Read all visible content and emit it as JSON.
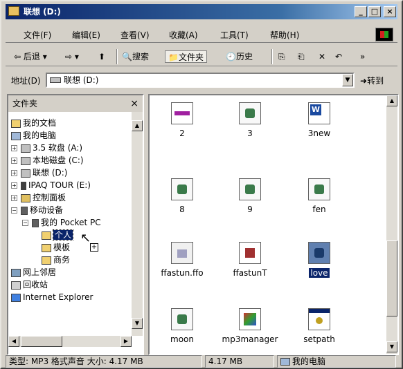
{
  "window": {
    "title": "联想 (D:)"
  },
  "menubar": {
    "items": [
      "文件(F)",
      "编辑(E)",
      "查看(V)",
      "收藏(A)",
      "工具(T)",
      "帮助(H)"
    ]
  },
  "toolbar": {
    "back": "后退",
    "search": "搜索",
    "folders": "文件夹",
    "history": "历史"
  },
  "address": {
    "label": "地址(D)",
    "value": "联想 (D:)",
    "go": "转到"
  },
  "folders_pane": {
    "title": "文件夹",
    "items": [
      "我的文档",
      "我的电脑",
      "3.5 软盘 (A:)",
      "本地磁盘 (C:)",
      "联想 (D:)",
      "IPAQ TOUR (E:)",
      "控制面板",
      "移动设备",
      "我的 Pocket PC",
      "个人",
      "模板",
      "商务",
      "网上邻居",
      "回收站",
      "Internet Explorer"
    ]
  },
  "files": [
    {
      "name": "2",
      "icon": "drag-file-icon"
    },
    {
      "name": "3",
      "icon": "sound-file-icon"
    },
    {
      "name": "3new",
      "icon": "word-document-icon"
    },
    {
      "name": "8",
      "icon": "sound-file-icon"
    },
    {
      "name": "9",
      "icon": "sound-file-icon"
    },
    {
      "name": "fen",
      "icon": "sound-file-icon"
    },
    {
      "name": "ffastun.ffo",
      "icon": "generic-file-icon"
    },
    {
      "name": "ffastunT",
      "icon": "application-icon"
    },
    {
      "name": "love",
      "icon": "sound-file-icon"
    },
    {
      "name": "moon",
      "icon": "sound-file-icon"
    },
    {
      "name": "mp3manager",
      "icon": "application-icon"
    },
    {
      "name": "setpath",
      "icon": "settings-window-icon"
    }
  ],
  "status": {
    "type": "类型: MP3 格式声音 大小: 4.17 MB",
    "size": "4.17 MB",
    "zone": "我的电脑"
  }
}
